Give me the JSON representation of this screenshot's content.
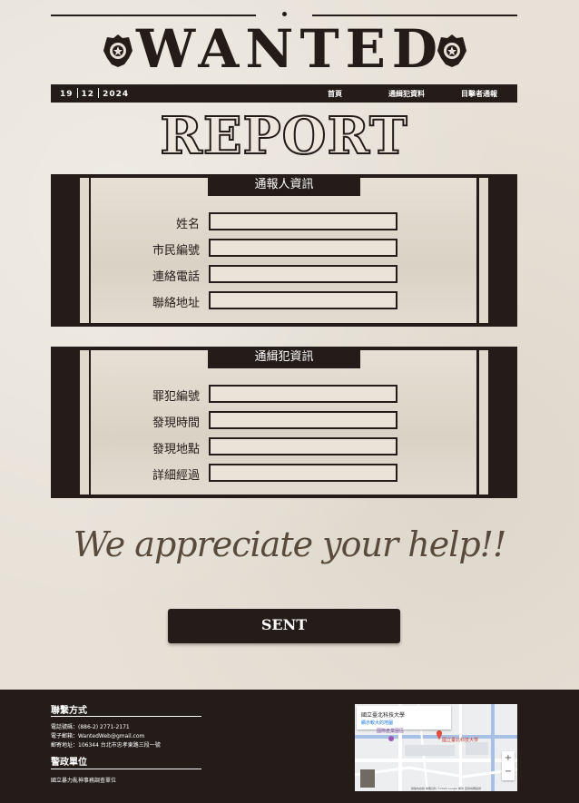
{
  "header": {
    "title": "WANTED",
    "date": {
      "day": "19",
      "month": "12",
      "year": "2024"
    },
    "nav": [
      "首頁",
      "通緝犯資料",
      "目擊者通報"
    ]
  },
  "page_title": "REPORT",
  "reporter_section": {
    "caption": "通報人資訊",
    "fields": [
      "姓名",
      "市民編號",
      "連絡電話",
      "聯絡地址"
    ]
  },
  "fugitive_section": {
    "caption": "通緝犯資訊",
    "fields": [
      "罪犯編號",
      "發現時間",
      "發現地點",
      "詳細經過"
    ]
  },
  "slogan": "We appreciate your help!!",
  "submit_label": "SENT",
  "footer": {
    "contact_heading": "聯繫方式",
    "phone": "電話號碼：(886-2) 2771-2171",
    "email": "電子郵箱：WantedWeb@gmail.com",
    "address": "郵寄地址：106344 台北市忠孝東路三段一號",
    "agency_heading": "警政單位",
    "agency": "國立暴力亂神事務調查單位",
    "map": {
      "place_name": "國立臺北科技大學",
      "link": "顯示較大的地圖",
      "pin_label": "國立臺北科技大學",
      "poi": "國際產業園區",
      "credits": "鍵盤快捷鍵  地圖資料 ©2024 Google  條款  回報地圖錯誤",
      "zoom_in": "+",
      "zoom_out": "−"
    }
  },
  "colors": {
    "dark": "#231c18",
    "paper": "#e7e1d7"
  }
}
